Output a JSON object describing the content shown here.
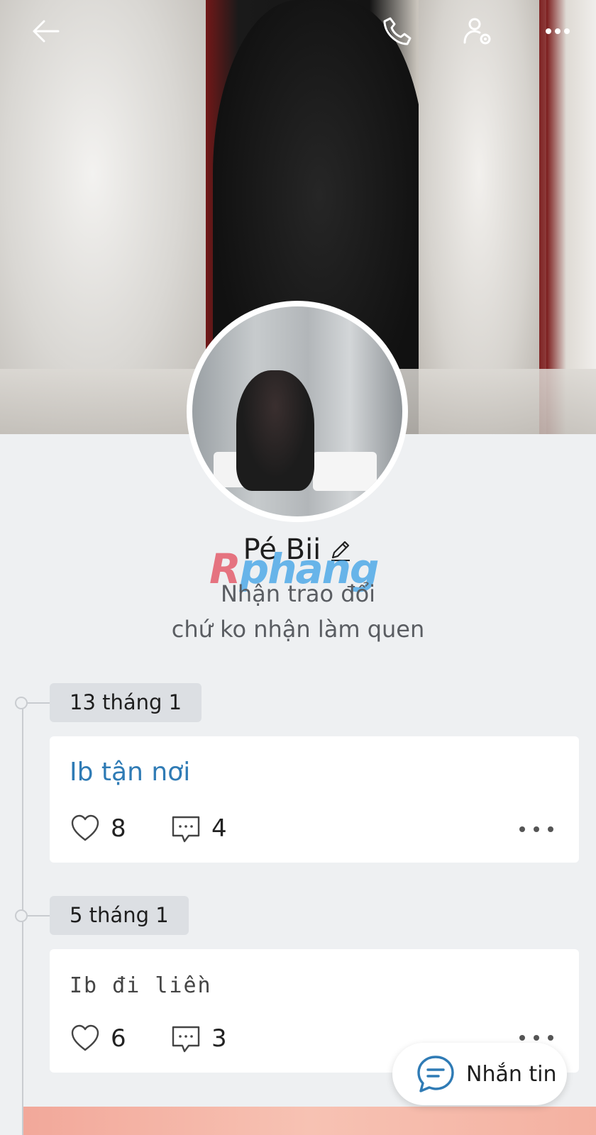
{
  "profile": {
    "name": "Pé Bii",
    "bio_line1": "Nhận trao đổi",
    "bio_line2": "chứ ko nhận làm quen"
  },
  "watermark": {
    "part1": "R",
    "part2": "phang"
  },
  "topbar": {
    "icons": [
      "back-arrow-icon",
      "phone-icon",
      "user-settings-icon",
      "more-icon"
    ]
  },
  "posts": [
    {
      "date": "13 tháng 1",
      "text": "Ib tận nơi",
      "likes": "8",
      "comments": "4"
    },
    {
      "date": "5 tháng 1",
      "text": "Ib đi liền",
      "likes": "6",
      "comments": "3"
    }
  ],
  "message_button": {
    "label": "Nhắn tin"
  },
  "colors": {
    "accent": "#2f7bb5",
    "background": "#eef0f2"
  }
}
